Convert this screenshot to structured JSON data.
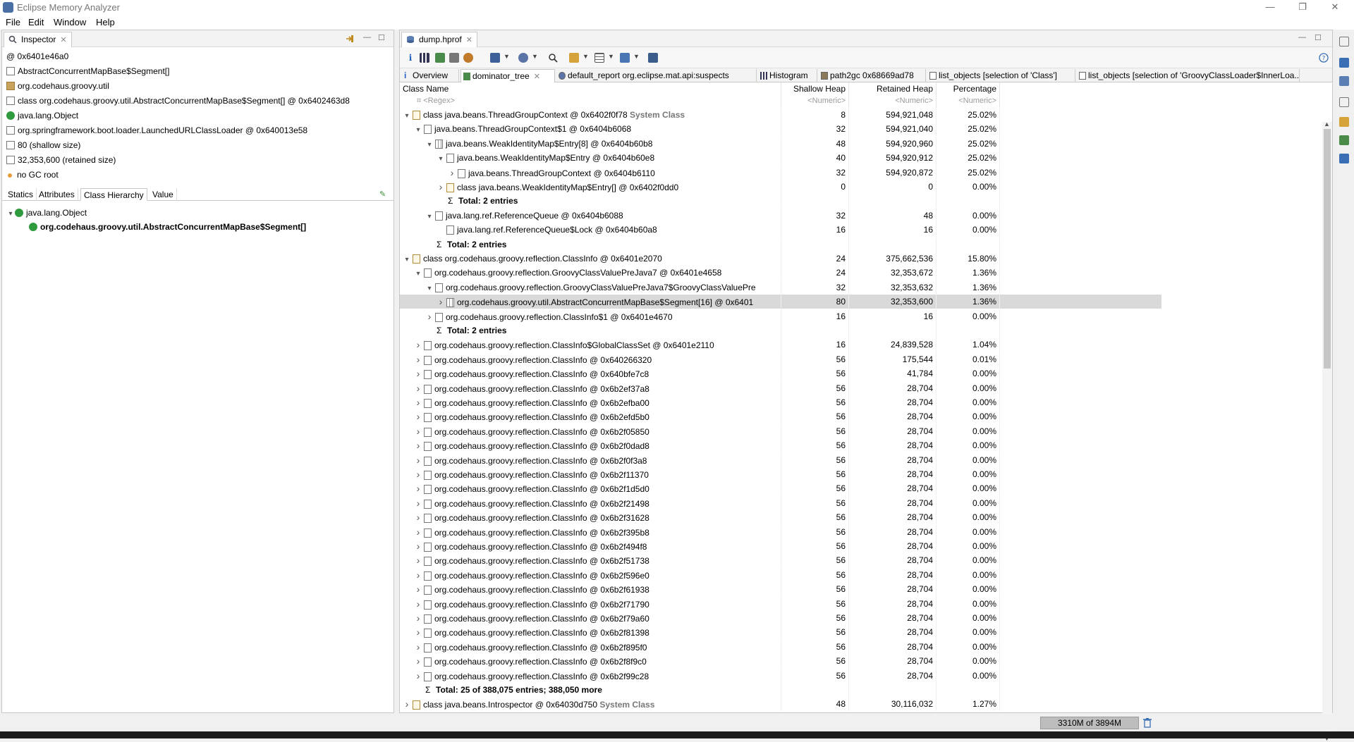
{
  "window": {
    "title": "Eclipse Memory Analyzer",
    "minimize": "—",
    "restore": "❐",
    "close": "✕"
  },
  "menu": [
    "File",
    "Edit",
    "Window",
    "Help"
  ],
  "inspector": {
    "tab_label": "Inspector",
    "address": "@ 0x6401e46a0",
    "items": [
      {
        "icon": "array-icon",
        "text": "AbstractConcurrentMapBase$Segment[]"
      },
      {
        "icon": "package-icon",
        "text": "org.codehaus.groovy.util"
      },
      {
        "icon": "class-icon",
        "text": "class org.codehaus.groovy.util.AbstractConcurrentMapBase$Segment[] @ 0x6402463d8"
      },
      {
        "icon": "superclass-icon",
        "text": "java.lang.Object"
      },
      {
        "icon": "classloader-icon",
        "text": "org.springframework.boot.loader.LaunchedURLClassLoader @ 0x640013e58"
      },
      {
        "icon": "size-icon",
        "text": "80 (shallow size)"
      },
      {
        "icon": "size-icon",
        "text": "32,353,600 (retained size)"
      },
      {
        "icon": "gc-root-icon",
        "text": "no GC root"
      }
    ],
    "subtabs": [
      "Statics",
      "Attributes",
      "Class Hierarchy",
      "Value"
    ],
    "active_subtab": "Class Hierarchy",
    "hierarchy": [
      "java.lang.Object",
      "org.codehaus.groovy.util.AbstractConcurrentMapBase$Segment[]"
    ]
  },
  "editor": {
    "file_tab": "dump.hprof",
    "query_tabs": [
      "Overview",
      "dominator_tree",
      "default_report  org.eclipse.mat.api:suspects",
      "Histogram",
      "path2gc 0x68669ad78",
      "list_objects [selection of 'Class']",
      "list_objects [selection of 'GroovyClassLoader$InnerLoa..."
    ],
    "active_query_tab": "dominator_tree"
  },
  "table": {
    "columns": [
      "Class Name",
      "Shallow Heap",
      "Retained Heap",
      "Percentage"
    ],
    "filters": [
      "<Regex>",
      "<Numeric>",
      "<Numeric>",
      "<Numeric>"
    ],
    "rows": [
      {
        "d": 0,
        "t": "open",
        "ic": "cls",
        "name": "class java.beans.ThreadGroupContext @ 0x6402f0f78",
        "tag": "System Class",
        "sh": "8",
        "rh": "594,921,048",
        "pc": "25.02%"
      },
      {
        "d": 1,
        "t": "open",
        "ic": "obj",
        "name": "java.beans.ThreadGroupContext$1 @ 0x6404b6068",
        "sh": "32",
        "rh": "594,921,040",
        "pc": "25.02%"
      },
      {
        "d": 2,
        "t": "open",
        "ic": "arr",
        "name": "java.beans.WeakIdentityMap$Entry[8] @ 0x6404b60b8",
        "sh": "48",
        "rh": "594,920,960",
        "pc": "25.02%"
      },
      {
        "d": 3,
        "t": "open",
        "ic": "obj",
        "name": "java.beans.WeakIdentityMap$Entry @ 0x6404b60e8",
        "sh": "40",
        "rh": "594,920,912",
        "pc": "25.02%"
      },
      {
        "d": 4,
        "t": "closed",
        "ic": "obj",
        "name": "java.beans.ThreadGroupContext @ 0x6404b6110",
        "sh": "32",
        "rh": "594,920,872",
        "pc": "25.02%"
      },
      {
        "d": 3,
        "t": "closed",
        "ic": "cls",
        "name": "class java.beans.WeakIdentityMap$Entry[] @ 0x6402f0dd0",
        "sh": "0",
        "rh": "0",
        "pc": "0.00%"
      },
      {
        "d": 3,
        "t": "none",
        "sum": true,
        "name": "Total: 2 entries"
      },
      {
        "d": 2,
        "t": "open",
        "ic": "obj",
        "name": "java.lang.ref.ReferenceQueue @ 0x6404b6088",
        "sh": "32",
        "rh": "48",
        "pc": "0.00%"
      },
      {
        "d": 3,
        "t": "none",
        "ic": "obj",
        "name": "java.lang.ref.ReferenceQueue$Lock @ 0x6404b60a8",
        "sh": "16",
        "rh": "16",
        "pc": "0.00%"
      },
      {
        "d": 2,
        "t": "none",
        "sum": true,
        "name": "Total: 2 entries"
      },
      {
        "d": 0,
        "t": "open",
        "ic": "cls",
        "name": "class org.codehaus.groovy.reflection.ClassInfo @ 0x6401e2070",
        "sh": "24",
        "rh": "375,662,536",
        "pc": "15.80%"
      },
      {
        "d": 1,
        "t": "open",
        "ic": "obj",
        "name": "org.codehaus.groovy.reflection.GroovyClassValuePreJava7 @ 0x6401e4658",
        "sh": "24",
        "rh": "32,353,672",
        "pc": "1.36%"
      },
      {
        "d": 2,
        "t": "open",
        "ic": "obj",
        "name": "org.codehaus.groovy.reflection.GroovyClassValuePreJava7$GroovyClassValuePre",
        "sh": "32",
        "rh": "32,353,632",
        "pc": "1.36%"
      },
      {
        "d": 3,
        "t": "closed",
        "ic": "arr",
        "sel": true,
        "name": "org.codehaus.groovy.util.AbstractConcurrentMapBase$Segment[16] @ 0x6401",
        "sh": "80",
        "rh": "32,353,600",
        "pc": "1.36%"
      },
      {
        "d": 2,
        "t": "closed",
        "ic": "obj",
        "name": "org.codehaus.groovy.reflection.ClassInfo$1 @ 0x6401e4670",
        "sh": "16",
        "rh": "16",
        "pc": "0.00%"
      },
      {
        "d": 2,
        "t": "none",
        "sum": true,
        "name": "Total: 2 entries"
      },
      {
        "d": 1,
        "t": "closed",
        "ic": "obj",
        "name": "org.codehaus.groovy.reflection.ClassInfo$GlobalClassSet @ 0x6401e2110",
        "sh": "16",
        "rh": "24,839,528",
        "pc": "1.04%"
      },
      {
        "d": 1,
        "t": "closed",
        "ic": "obj",
        "name": "org.codehaus.groovy.reflection.ClassInfo @ 0x640266320",
        "sh": "56",
        "rh": "175,544",
        "pc": "0.01%"
      },
      {
        "d": 1,
        "t": "closed",
        "ic": "obj",
        "name": "org.codehaus.groovy.reflection.ClassInfo @ 0x640bfe7c8",
        "sh": "56",
        "rh": "41,784",
        "pc": "0.00%"
      },
      {
        "d": 1,
        "t": "closed",
        "ic": "obj",
        "name": "org.codehaus.groovy.reflection.ClassInfo @ 0x6b2ef37a8",
        "sh": "56",
        "rh": "28,704",
        "pc": "0.00%"
      },
      {
        "d": 1,
        "t": "closed",
        "ic": "obj",
        "name": "org.codehaus.groovy.reflection.ClassInfo @ 0x6b2efba00",
        "sh": "56",
        "rh": "28,704",
        "pc": "0.00%"
      },
      {
        "d": 1,
        "t": "closed",
        "ic": "obj",
        "name": "org.codehaus.groovy.reflection.ClassInfo @ 0x6b2efd5b0",
        "sh": "56",
        "rh": "28,704",
        "pc": "0.00%"
      },
      {
        "d": 1,
        "t": "closed",
        "ic": "obj",
        "name": "org.codehaus.groovy.reflection.ClassInfo @ 0x6b2f05850",
        "sh": "56",
        "rh": "28,704",
        "pc": "0.00%"
      },
      {
        "d": 1,
        "t": "closed",
        "ic": "obj",
        "name": "org.codehaus.groovy.reflection.ClassInfo @ 0x6b2f0dad8",
        "sh": "56",
        "rh": "28,704",
        "pc": "0.00%"
      },
      {
        "d": 1,
        "t": "closed",
        "ic": "obj",
        "name": "org.codehaus.groovy.reflection.ClassInfo @ 0x6b2f0f3a8",
        "sh": "56",
        "rh": "28,704",
        "pc": "0.00%"
      },
      {
        "d": 1,
        "t": "closed",
        "ic": "obj",
        "name": "org.codehaus.groovy.reflection.ClassInfo @ 0x6b2f11370",
        "sh": "56",
        "rh": "28,704",
        "pc": "0.00%"
      },
      {
        "d": 1,
        "t": "closed",
        "ic": "obj",
        "name": "org.codehaus.groovy.reflection.ClassInfo @ 0x6b2f1d5d0",
        "sh": "56",
        "rh": "28,704",
        "pc": "0.00%"
      },
      {
        "d": 1,
        "t": "closed",
        "ic": "obj",
        "name": "org.codehaus.groovy.reflection.ClassInfo @ 0x6b2f21498",
        "sh": "56",
        "rh": "28,704",
        "pc": "0.00%"
      },
      {
        "d": 1,
        "t": "closed",
        "ic": "obj",
        "name": "org.codehaus.groovy.reflection.ClassInfo @ 0x6b2f31628",
        "sh": "56",
        "rh": "28,704",
        "pc": "0.00%"
      },
      {
        "d": 1,
        "t": "closed",
        "ic": "obj",
        "name": "org.codehaus.groovy.reflection.ClassInfo @ 0x6b2f395b8",
        "sh": "56",
        "rh": "28,704",
        "pc": "0.00%"
      },
      {
        "d": 1,
        "t": "closed",
        "ic": "obj",
        "name": "org.codehaus.groovy.reflection.ClassInfo @ 0x6b2f494f8",
        "sh": "56",
        "rh": "28,704",
        "pc": "0.00%"
      },
      {
        "d": 1,
        "t": "closed",
        "ic": "obj",
        "name": "org.codehaus.groovy.reflection.ClassInfo @ 0x6b2f51738",
        "sh": "56",
        "rh": "28,704",
        "pc": "0.00%"
      },
      {
        "d": 1,
        "t": "closed",
        "ic": "obj",
        "name": "org.codehaus.groovy.reflection.ClassInfo @ 0x6b2f596e0",
        "sh": "56",
        "rh": "28,704",
        "pc": "0.00%"
      },
      {
        "d": 1,
        "t": "closed",
        "ic": "obj",
        "name": "org.codehaus.groovy.reflection.ClassInfo @ 0x6b2f61938",
        "sh": "56",
        "rh": "28,704",
        "pc": "0.00%"
      },
      {
        "d": 1,
        "t": "closed",
        "ic": "obj",
        "name": "org.codehaus.groovy.reflection.ClassInfo @ 0x6b2f71790",
        "sh": "56",
        "rh": "28,704",
        "pc": "0.00%"
      },
      {
        "d": 1,
        "t": "closed",
        "ic": "obj",
        "name": "org.codehaus.groovy.reflection.ClassInfo @ 0x6b2f79a60",
        "sh": "56",
        "rh": "28,704",
        "pc": "0.00%"
      },
      {
        "d": 1,
        "t": "closed",
        "ic": "obj",
        "name": "org.codehaus.groovy.reflection.ClassInfo @ 0x6b2f81398",
        "sh": "56",
        "rh": "28,704",
        "pc": "0.00%"
      },
      {
        "d": 1,
        "t": "closed",
        "ic": "obj",
        "name": "org.codehaus.groovy.reflection.ClassInfo @ 0x6b2f895f0",
        "sh": "56",
        "rh": "28,704",
        "pc": "0.00%"
      },
      {
        "d": 1,
        "t": "closed",
        "ic": "obj",
        "name": "org.codehaus.groovy.reflection.ClassInfo @ 0x6b2f8f9c0",
        "sh": "56",
        "rh": "28,704",
        "pc": "0.00%"
      },
      {
        "d": 1,
        "t": "closed",
        "ic": "obj",
        "name": "org.codehaus.groovy.reflection.ClassInfo @ 0x6b2f99c28",
        "sh": "56",
        "rh": "28,704",
        "pc": "0.00%"
      },
      {
        "d": 1,
        "t": "none",
        "sum": true,
        "name": "Total: 25 of 388,075 entries; 388,050 more"
      },
      {
        "d": 0,
        "t": "closed",
        "ic": "cls",
        "name": "class java.beans.Introspector @ 0x64030d750",
        "tag": "System Class",
        "sh": "48",
        "rh": "30,116,032",
        "pc": "1.27%"
      }
    ]
  },
  "status": {
    "heap": "3310M of 3894M"
  },
  "colors": {
    "selection": "#d9d9d9",
    "class_icon": "#2f9a3e",
    "heap_bar": "#bdbdbd"
  }
}
